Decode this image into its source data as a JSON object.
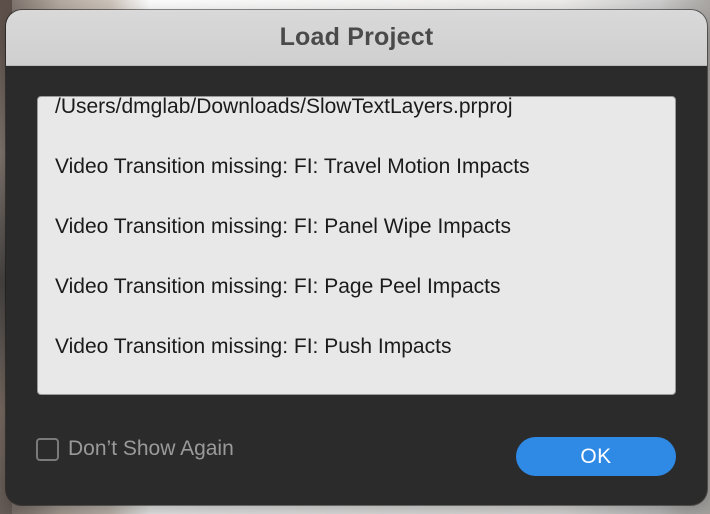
{
  "dialog": {
    "title": "Load Project",
    "messages": [
      "/Users/dmglab/Downloads/SlowTextLayers.prproj",
      "Video Transition missing:  FI: Travel Motion Impacts",
      "Video Transition missing:  FI: Panel Wipe Impacts",
      "Video Transition missing:  FI: Page Peel Impacts",
      "Video Transition missing:  FI: Push Impacts"
    ],
    "dont_show_again_label": "Don’t Show Again",
    "dont_show_again_checked": false,
    "ok_label": "OK"
  },
  "colors": {
    "dialog_background": "#2b2b2b",
    "titlebar_background": "#d9d9d9",
    "message_box_background": "#e8e8e8",
    "ok_button_accent": "#2f8ae6"
  }
}
